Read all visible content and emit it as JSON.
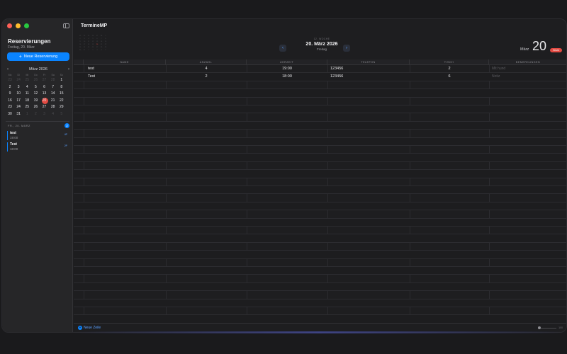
{
  "sidebar": {
    "title": "Reservierungen",
    "subtitle": "Freitag, 20. März",
    "new_button": "Neue Reservierung",
    "calendar": {
      "month": "März 2026",
      "weekdays": [
        "Mo",
        "Di",
        "Mi",
        "Do",
        "Fr",
        "Sa",
        "So"
      ],
      "days": [
        {
          "d": "23",
          "m": true
        },
        {
          "d": "24",
          "m": true
        },
        {
          "d": "25",
          "m": true
        },
        {
          "d": "26",
          "m": true
        },
        {
          "d": "27",
          "m": true
        },
        {
          "d": "28",
          "m": true
        },
        {
          "d": "1"
        },
        {
          "d": "2"
        },
        {
          "d": "3"
        },
        {
          "d": "4"
        },
        {
          "d": "5"
        },
        {
          "d": "6"
        },
        {
          "d": "7"
        },
        {
          "d": "8"
        },
        {
          "d": "9"
        },
        {
          "d": "10"
        },
        {
          "d": "11"
        },
        {
          "d": "12"
        },
        {
          "d": "13"
        },
        {
          "d": "14"
        },
        {
          "d": "15"
        },
        {
          "d": "16"
        },
        {
          "d": "17"
        },
        {
          "d": "18"
        },
        {
          "d": "19"
        },
        {
          "d": "20",
          "t": true
        },
        {
          "d": "21"
        },
        {
          "d": "22"
        },
        {
          "d": "23"
        },
        {
          "d": "24"
        },
        {
          "d": "25"
        },
        {
          "d": "26"
        },
        {
          "d": "27"
        },
        {
          "d": "28"
        },
        {
          "d": "29"
        },
        {
          "d": "30"
        },
        {
          "d": "31"
        },
        {
          "d": "1",
          "m": true
        },
        {
          "d": "2",
          "m": true
        },
        {
          "d": "3",
          "m": true
        },
        {
          "d": "4",
          "m": true
        },
        {
          "d": "5",
          "m": true
        }
      ]
    },
    "agenda": {
      "heading": "FR., 20. MÄRZ",
      "count": "2",
      "items": [
        {
          "name": "test",
          "time": "19:00",
          "tag": "4P"
        },
        {
          "name": "Test",
          "time": "18:00",
          "tag": "2P"
        }
      ]
    }
  },
  "main": {
    "app_title": "TermineMP",
    "week_label": "12. WOCHE",
    "date": "20. März 2026",
    "weekday": "Freitag",
    "big_month": "März",
    "big_day": "20",
    "today_badge": "Heute",
    "columns": [
      "NAME",
      "ANZAHL",
      "UHRZEIT",
      "TELEFON",
      "TISCH",
      "BEMERKUNGEN"
    ],
    "rows": [
      {
        "name": "test",
        "anzahl": "4",
        "uhrzeit": "19:00",
        "telefon": "123456",
        "tisch": "2",
        "bemerkung": "Mit hund"
      },
      {
        "name": "Test",
        "anzahl": "2",
        "uhrzeit": "18:00",
        "telefon": "123456",
        "tisch": "6",
        "bemerkung": "Notiz"
      }
    ],
    "footer_new_row": "Neue Zeile",
    "zoom_value": "100"
  },
  "colors": {
    "accent": "#0a84ff",
    "today": "#e24a42",
    "background": "#1e1e20"
  }
}
